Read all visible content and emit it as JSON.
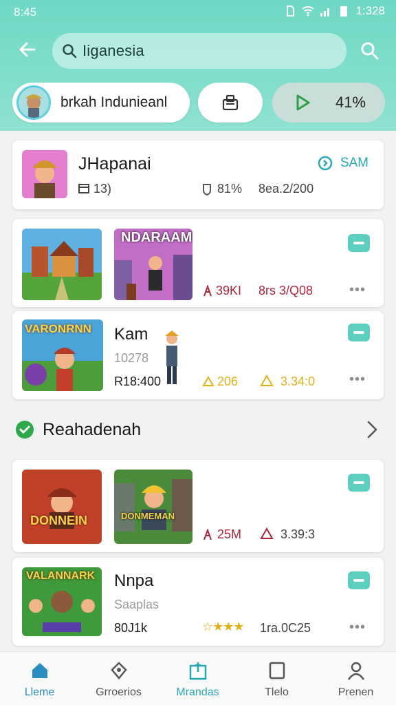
{
  "status_bar": {
    "time": "8:45",
    "clock_right": "1:328"
  },
  "header": {
    "search": {
      "value": "Iiganesia"
    },
    "profile_chip_label": "brkah Indunieanl",
    "play_chip_value": "41%"
  },
  "featured": {
    "title": "JHapanai",
    "meta1": "13)",
    "meta2": "81%",
    "meta3": "8ea.2/200",
    "action_label": "SAM"
  },
  "row1": {
    "thumb2_text": "NDARAAM",
    "stat1": "39KI",
    "stat2": "8rs 3/Q08"
  },
  "row2": {
    "thumb_text": "VARONRNN",
    "title": "Kam",
    "subtitle": "10278",
    "price": "R18:400",
    "stat1": "206",
    "stat2": "3.34:0"
  },
  "section": {
    "title": "Reahadenah"
  },
  "row3": {
    "thumb1_text": "DONNEIN",
    "thumb2_text": "DONMEMAN",
    "stat1": "25M",
    "stat2": "3.39:3"
  },
  "row4": {
    "thumb_text": "VALANNARK",
    "title": "Nnpa",
    "subtitle": "Saaplas",
    "price": "80J1k",
    "stat2": "1ra.0C25"
  },
  "nav": [
    {
      "label": "Lleme"
    },
    {
      "label": "Grroerios"
    },
    {
      "label": "Mrandas"
    },
    {
      "label": "Tlelo"
    },
    {
      "label": "Prenen"
    }
  ],
  "colors": {
    "header": "#6ed8c4",
    "accent": "#5ccfbf",
    "active_nav": "#2aa7b5",
    "stat_red": "#b0243a",
    "stat_gold": "#e2b11a",
    "check_green": "#2ea84a"
  }
}
